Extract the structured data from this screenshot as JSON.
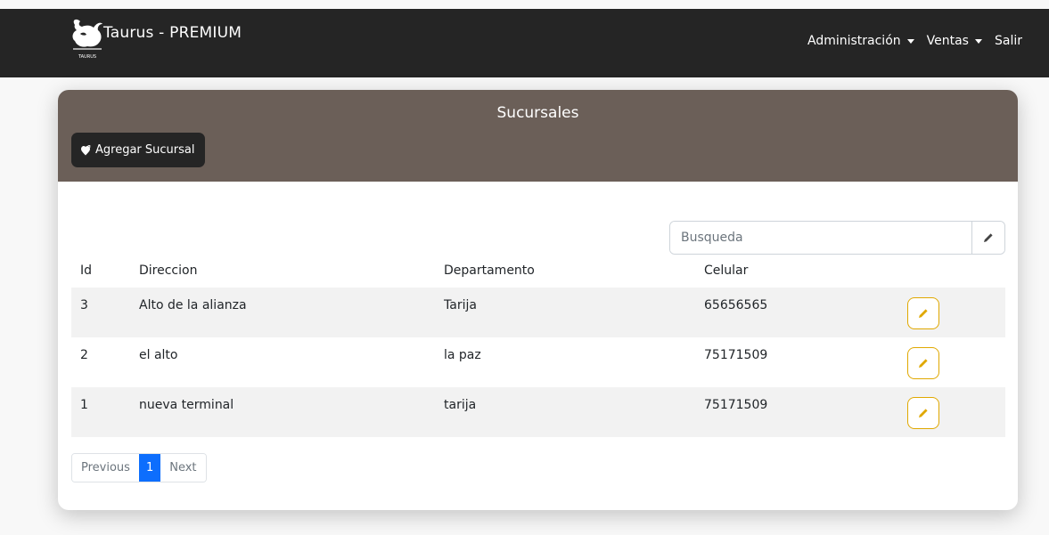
{
  "navbar": {
    "brand_title": "Taurus - PREMIUM",
    "logo_caption": "TAURUS",
    "menu": [
      {
        "label": "Administración",
        "has_dropdown": true
      },
      {
        "label": "Ventas",
        "has_dropdown": true
      },
      {
        "label": "Salir",
        "has_dropdown": false
      }
    ]
  },
  "card": {
    "title": "Sucursales",
    "add_button_label": "Agregar Sucursal",
    "search": {
      "placeholder": "Busqueda",
      "value": ""
    },
    "table": {
      "headers": [
        "Id",
        "Direccion",
        "Departamento",
        "Celular"
      ],
      "rows": [
        {
          "id": "3",
          "direccion": "Alto de la alianza",
          "departamento": "Tarija",
          "celular": "65656565"
        },
        {
          "id": "2",
          "direccion": "el alto",
          "departamento": "la paz",
          "celular": "75171509"
        },
        {
          "id": "1",
          "direccion": "nueva terminal",
          "departamento": "tarija",
          "celular": "75171509"
        }
      ]
    },
    "pagination": {
      "previous": "Previous",
      "current": "1",
      "next": "Next"
    }
  },
  "colors": {
    "navbar_bg": "#252525",
    "card_header_bg": "#6b5f58",
    "accent_blue": "#0d6efd",
    "edit_yellow": "#e0a800"
  },
  "icons": {
    "add_button": "map-pin-heart-icon",
    "search_button": "pencil-icon",
    "row_edit": "pencil-icon",
    "brand": "bull-logo-icon"
  }
}
